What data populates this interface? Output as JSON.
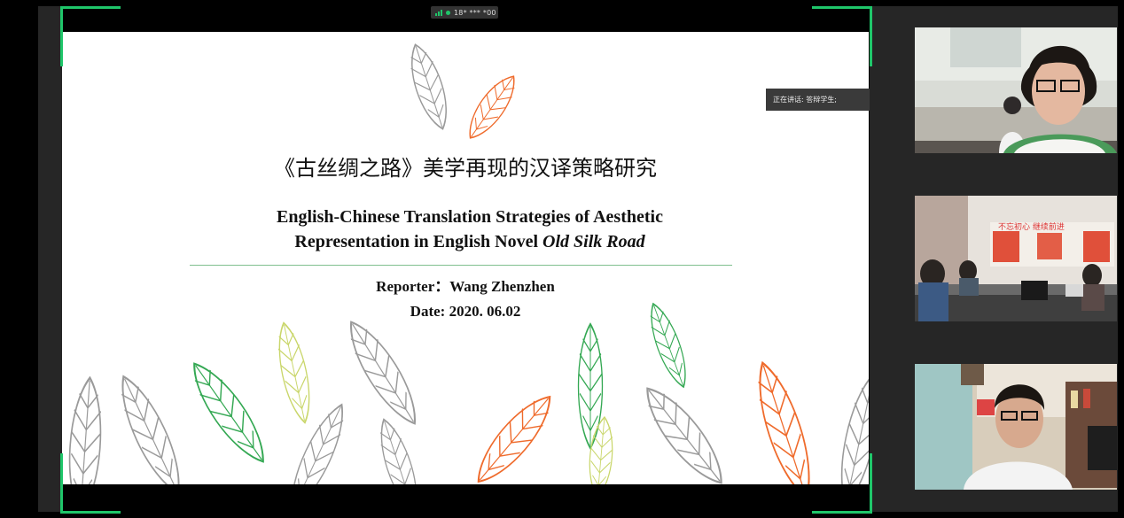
{
  "status_bar": {
    "meeting_id": "18* *** *00"
  },
  "speaker_indicator": {
    "label": "正在讲话: 答辩学生;"
  },
  "slide": {
    "title_cn": "《古丝绸之路》美学再现的汉译策略研究",
    "title_en_line1": "English-Chinese Translation Strategies of Aesthetic",
    "title_en_line2_prefix": "Representation in English Novel ",
    "title_en_line2_italic": "Old Silk Road",
    "reporter": "Reporter：Wang Zhenzhen",
    "date": "Date:  2020. 06.02"
  },
  "participants": [
    {
      "id": "participant-1"
    },
    {
      "id": "participant-2",
      "banner_text": "不忘初心  继续前进"
    },
    {
      "id": "participant-3"
    }
  ],
  "colors": {
    "accent_green": "#1fc66a",
    "leaf_gray": "#9a9a9a",
    "leaf_green": "#34a853",
    "leaf_orange": "#ef6b2c",
    "leaf_yellow": "#c9d66a"
  },
  "icons": [
    "signal-icon",
    "connected-dot-icon"
  ]
}
